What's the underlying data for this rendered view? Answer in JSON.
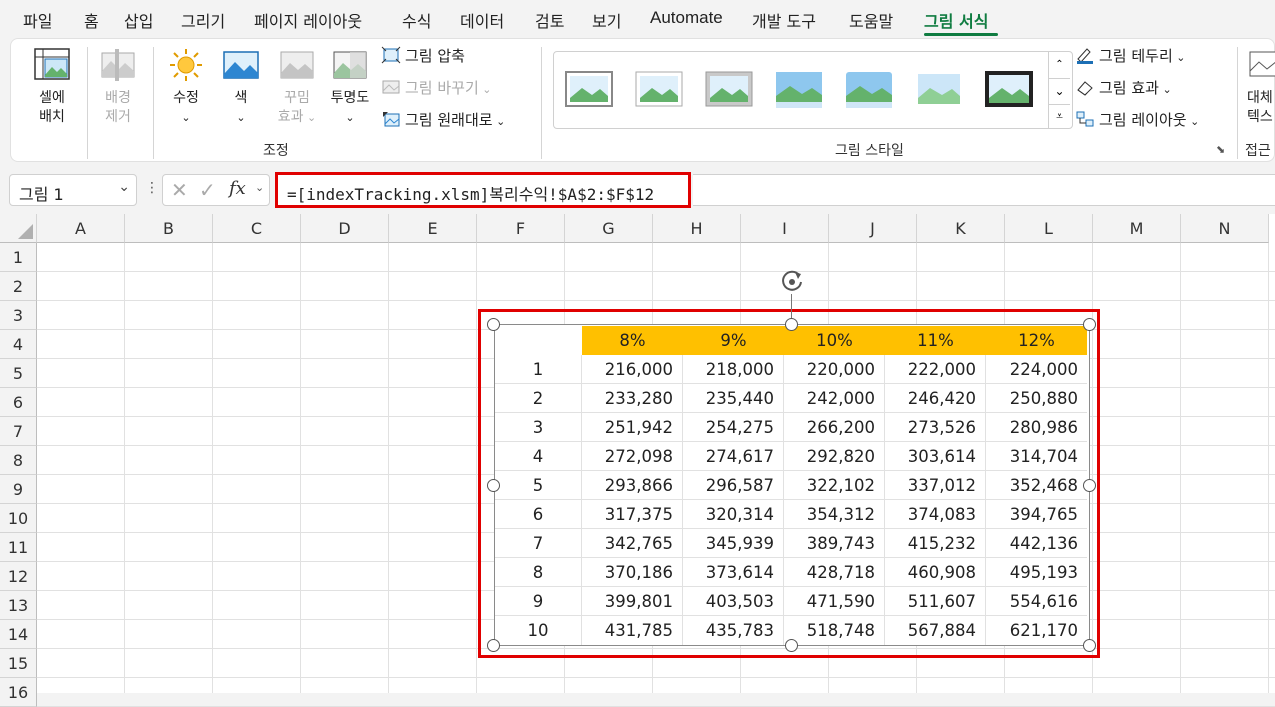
{
  "menu": {
    "items": [
      "파일",
      "홈",
      "삽입",
      "그리기",
      "페이지 레이아웃",
      "수식",
      "데이터",
      "검토",
      "보기",
      "Automate",
      "개발 도구",
      "도움말",
      "그림 서식"
    ],
    "active": "그림 서식"
  },
  "ribbon": {
    "select_pane": [
      "셀에",
      "배치"
    ],
    "remove_background": [
      "배경",
      "제거"
    ],
    "corrections": "수정",
    "color": "색",
    "artistic_effects": [
      "꾸밈",
      "효과"
    ],
    "transparency": "투명도",
    "compress": "그림 압축",
    "change_picture": "그림 바꾸기",
    "reset_picture": "그림 원래대로",
    "group_adjust": "조정",
    "group_styles": "그림 스타일",
    "border": "그림 테두리",
    "effects": "그림 효과",
    "layout": "그림 레이아웃",
    "alt_text": [
      "대체",
      "텍스"
    ],
    "group_access": "접근"
  },
  "formula_bar": {
    "name_box": "그림 1",
    "fx": "fx",
    "formula": "=[indexTracking.xlsm]복리수익!$A$2:$F$12"
  },
  "sheet": {
    "columns": [
      "A",
      "B",
      "C",
      "D",
      "E",
      "F",
      "G",
      "H",
      "I",
      "J",
      "K",
      "L",
      "M",
      "N"
    ],
    "rows": [
      "1",
      "2",
      "3",
      "4",
      "5",
      "6",
      "7",
      "8",
      "9",
      "10",
      "11",
      "12",
      "13",
      "14",
      "15",
      "16"
    ]
  },
  "picture_table": {
    "headers": [
      "",
      "8%",
      "9%",
      "10%",
      "11%",
      "12%"
    ],
    "rows": [
      [
        "1",
        "216,000",
        "218,000",
        "220,000",
        "222,000",
        "224,000"
      ],
      [
        "2",
        "233,280",
        "235,440",
        "242,000",
        "246,420",
        "250,880"
      ],
      [
        "3",
        "251,942",
        "254,275",
        "266,200",
        "273,526",
        "280,986"
      ],
      [
        "4",
        "272,098",
        "274,617",
        "292,820",
        "303,614",
        "314,704"
      ],
      [
        "5",
        "293,866",
        "296,587",
        "322,102",
        "337,012",
        "352,468"
      ],
      [
        "6",
        "317,375",
        "320,314",
        "354,312",
        "374,083",
        "394,765"
      ],
      [
        "7",
        "342,765",
        "345,939",
        "389,743",
        "415,232",
        "442,136"
      ],
      [
        "8",
        "370,186",
        "373,614",
        "428,718",
        "460,908",
        "495,193"
      ],
      [
        "9",
        "399,801",
        "403,503",
        "471,590",
        "511,607",
        "554,616"
      ],
      [
        "10",
        "431,785",
        "435,783",
        "518,748",
        "567,884",
        "621,170"
      ]
    ],
    "header_color": "#ffc000"
  },
  "colors": {
    "accent": "#107c41",
    "highlight": "#e00000"
  }
}
